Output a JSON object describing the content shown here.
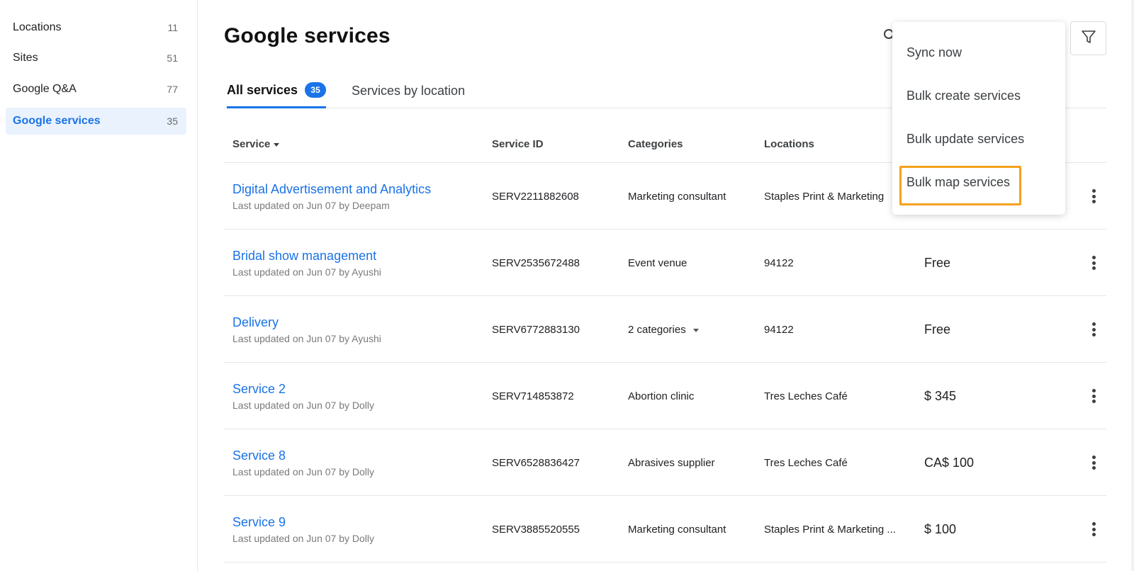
{
  "sidebar": {
    "items": [
      {
        "label": "Locations",
        "count": "11"
      },
      {
        "label": "Sites",
        "count": "51"
      },
      {
        "label": "Google Q&A",
        "count": "77"
      },
      {
        "label": "Google services",
        "count": "35"
      }
    ]
  },
  "header": {
    "title": "Google services"
  },
  "tabs": [
    {
      "label": "All services",
      "badge": "35"
    },
    {
      "label": "Services by location"
    }
  ],
  "table": {
    "columns": [
      "Service",
      "Service ID",
      "Categories",
      "Locations"
    ],
    "rows": [
      {
        "name": "Digital Advertisement and Analytics",
        "updated": "Last updated on Jun 07 by Deepam",
        "id": "SERV2211882608",
        "category": "Marketing consultant",
        "location": "Staples Print & Marketing",
        "price": ""
      },
      {
        "name": "Bridal show management",
        "updated": "Last updated on Jun 07 by Ayushi",
        "id": "SERV2535672488",
        "category": "Event venue",
        "location": "94122",
        "price": "Free"
      },
      {
        "name": "Delivery",
        "updated": "Last updated on Jun 07 by Ayushi",
        "id": "SERV6772883130",
        "category": "2 categories",
        "location": "94122",
        "price": "Free"
      },
      {
        "name": "Service 2",
        "updated": "Last updated on Jun 07 by Dolly",
        "id": "SERV714853872",
        "category": "Abortion clinic",
        "location": "Tres Leches Café",
        "price": "$ 345"
      },
      {
        "name": "Service 8",
        "updated": "Last updated on Jun 07 by Dolly",
        "id": "SERV6528836427",
        "category": "Abrasives supplier",
        "location": "Tres Leches Café",
        "price": "CA$ 100"
      },
      {
        "name": "Service 9",
        "updated": "Last updated on Jun 07 by Dolly",
        "id": "SERV3885520555",
        "category": "Marketing consultant",
        "location": "Staples Print & Marketing ...",
        "price": "$ 100"
      }
    ]
  },
  "menu": {
    "items": [
      "Sync now",
      "Bulk create services",
      "Bulk update services",
      "Bulk map services"
    ]
  },
  "colors": {
    "accent": "#1a73e8",
    "highlight": "#f5a11c"
  },
  "icons": {
    "search": "search-icon",
    "filter": "filter-icon",
    "more": "more-vert-icon"
  }
}
